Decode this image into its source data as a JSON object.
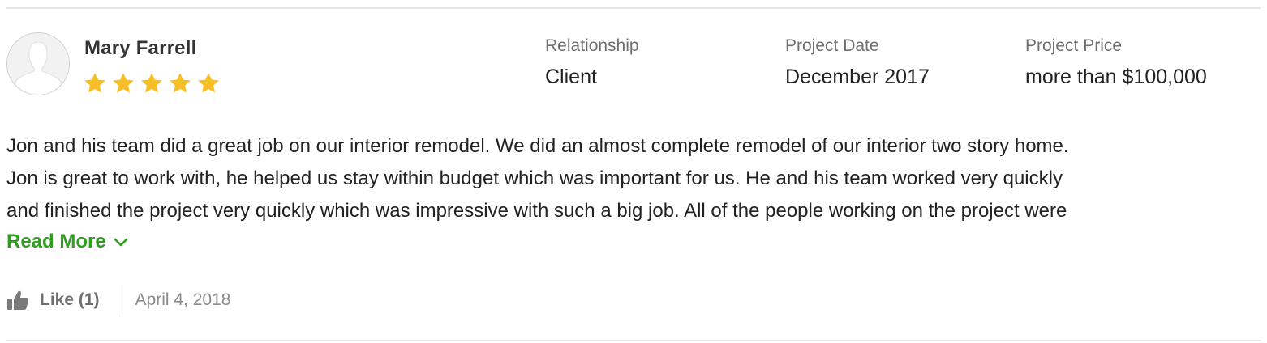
{
  "review": {
    "reviewer_name": "Mary Farrell",
    "rating": 5,
    "rating_max": 5,
    "star_color": "#f8be25",
    "meta": [
      {
        "label": "Relationship",
        "value": "Client"
      },
      {
        "label": "Project Date",
        "value": "December 2017"
      },
      {
        "label": "Project Price",
        "value": "more than $100,000"
      }
    ],
    "body_lines": [
      "Jon and his team did a great job on our interior remodel. We did an almost complete remodel of our interior two story home.",
      "Jon is great to work with, he helped us stay within budget which was important for us. He and his team worked very quickly",
      "and finished the project very quickly which was impressive with such a big job. All of the people working on the project were"
    ],
    "read_more_label": "Read More",
    "read_more_color": "#2f9e1f",
    "like_label": "Like (1)",
    "date": "April 4, 2018"
  },
  "icons": {
    "avatar": "default-user-silhouette",
    "star": "star-icon",
    "chevron": "chevron-down-icon",
    "like": "thumbs-up-icon"
  }
}
